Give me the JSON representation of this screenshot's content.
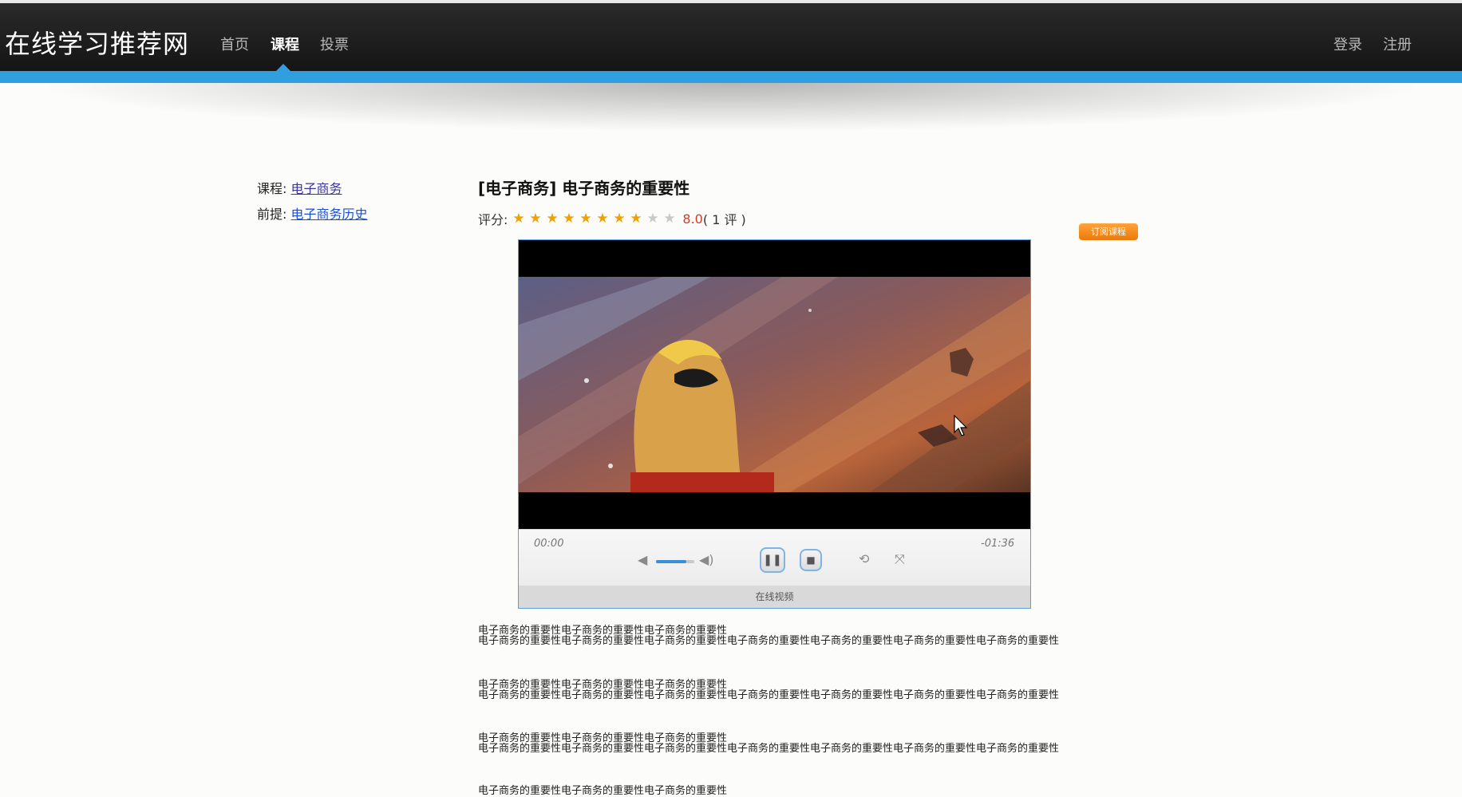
{
  "header": {
    "brand": "在线学习推荐网",
    "nav": [
      {
        "label": "首页",
        "active": false
      },
      {
        "label": "课程",
        "active": true
      },
      {
        "label": "投票",
        "active": false
      }
    ],
    "login": "登录",
    "register": "注册",
    "accent_color": "#2f9fe0"
  },
  "sidebar": {
    "course_label": "课程:",
    "course_link": "电子商务",
    "prereq_label": "前提:",
    "prereq_link": "电子商务历史"
  },
  "lesson": {
    "title": "[电子商务] 电子商务的重要性",
    "rating_label": "评分:",
    "rating": 8.0,
    "rating_text": "8.0",
    "stars_filled": 8,
    "stars_total": 10,
    "review_count": "( 1 评 )",
    "subscribe_button": "订阅课程"
  },
  "player": {
    "time_elapsed": "00:00",
    "time_remaining": "-01:36",
    "label": "在线视频",
    "volume": 0.8,
    "icons": [
      "mute-icon",
      "volume-icon",
      "pause-icon",
      "stop-icon",
      "loop-icon",
      "fullscreen-icon"
    ]
  },
  "content": {
    "paragraphs": [
      {
        "line1": "电子商务的重要性电子商务的重要性电子商务的重要性",
        "line2": "电子商务的重要性电子商务的重要性电子商务的重要性电子商务的重要性电子商务的重要性电子商务的重要性电子商务的重要性"
      },
      {
        "line1": "电子商务的重要性电子商务的重要性电子商务的重要性",
        "line2": "电子商务的重要性电子商务的重要性电子商务的重要性电子商务的重要性电子商务的重要性电子商务的重要性电子商务的重要性"
      },
      {
        "line1": "电子商务的重要性电子商务的重要性电子商务的重要性",
        "line2": "电子商务的重要性电子商务的重要性电子商务的重要性电子商务的重要性电子商务的重要性电子商务的重要性电子商务的重要性"
      },
      {
        "line1": "电子商务的重要性电子商务的重要性电子商务的重要性",
        "line2": ""
      }
    ]
  }
}
